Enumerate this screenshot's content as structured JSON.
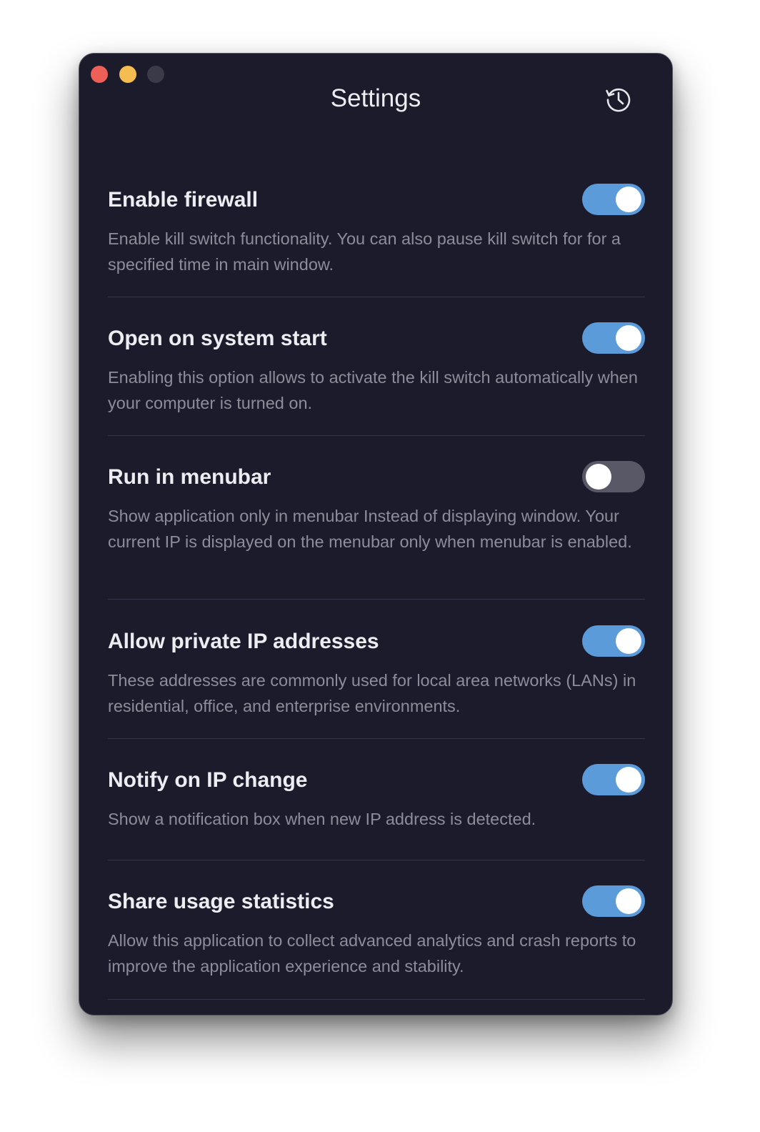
{
  "window": {
    "title": "Settings",
    "buttons": [
      "close",
      "minimize",
      "zoom"
    ],
    "history_icon": "history-clock-icon"
  },
  "settings": [
    {
      "title": "Enable firewall",
      "description": "Enable kill switch functionality. You can also pause kill switch for for a specified time in main window.",
      "enabled": true
    },
    {
      "title": "Open on system start",
      "description": "Enabling this option allows to activate the kill switch automatically when your computer is turned on.",
      "enabled": true
    },
    {
      "title": "Run in menubar",
      "description": "Show application only in menubar Instead of displaying window. Your current IP is displayed on the menubar only when menubar is enabled.",
      "enabled": false
    },
    {
      "title": "Allow private IP addresses",
      "description": "These addresses are commonly used for local area networks (LANs) in residential, office, and enterprise environments.",
      "enabled": true
    },
    {
      "title": "Notify on IP change",
      "description": "Show a notification box when new IP address is detected.",
      "enabled": true
    },
    {
      "title": "Share usage statistics",
      "description": "Allow this application to collect advanced analytics and crash reports to improve the application experience and stability.",
      "enabled": true
    }
  ],
  "colors": {
    "background": "#1b1b2b",
    "toggle_on": "#5b9bd9",
    "toggle_off": "#585866",
    "title_text": "#ececf1",
    "description_text": "#8d8d9a"
  }
}
